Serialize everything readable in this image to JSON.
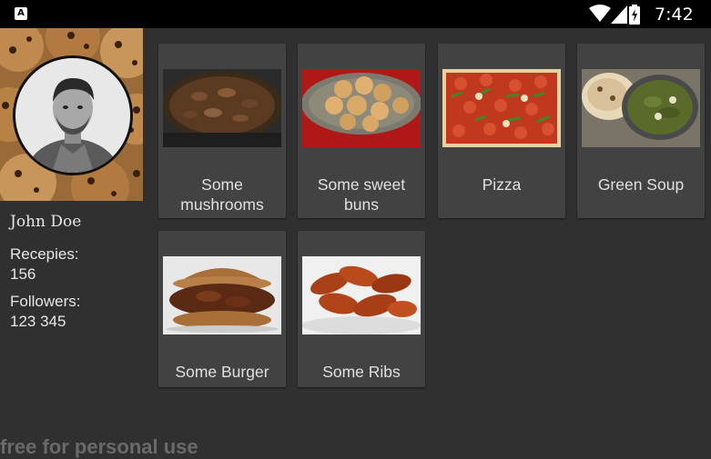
{
  "status_bar": {
    "time": "7:42",
    "icons": [
      "app-notification-icon",
      "wifi-icon",
      "signal-icon",
      "battery-charging-icon"
    ],
    "app_icon_letter": "A"
  },
  "profile": {
    "name": "John Doe",
    "recipes_label": "Recepies:",
    "recipes_value": "156",
    "followers_label": "Followers:",
    "followers_value": "123 345"
  },
  "recipes": [
    {
      "title": "Some mushrooms",
      "image": "mushrooms-image"
    },
    {
      "title": "Some sweet buns",
      "image": "sweet-buns-image"
    },
    {
      "title": "Pizza",
      "image": "pizza-image"
    },
    {
      "title": "Green Soup",
      "image": "green-soup-image"
    },
    {
      "title": "Some Burger",
      "image": "burger-image"
    },
    {
      "title": "Some Ribs",
      "image": "ribs-image"
    }
  ],
  "watermark": "free for personal use",
  "colors": {
    "background": "#303030",
    "card": "#424242",
    "status_bar": "#000000",
    "text": "#e0e0e0"
  }
}
